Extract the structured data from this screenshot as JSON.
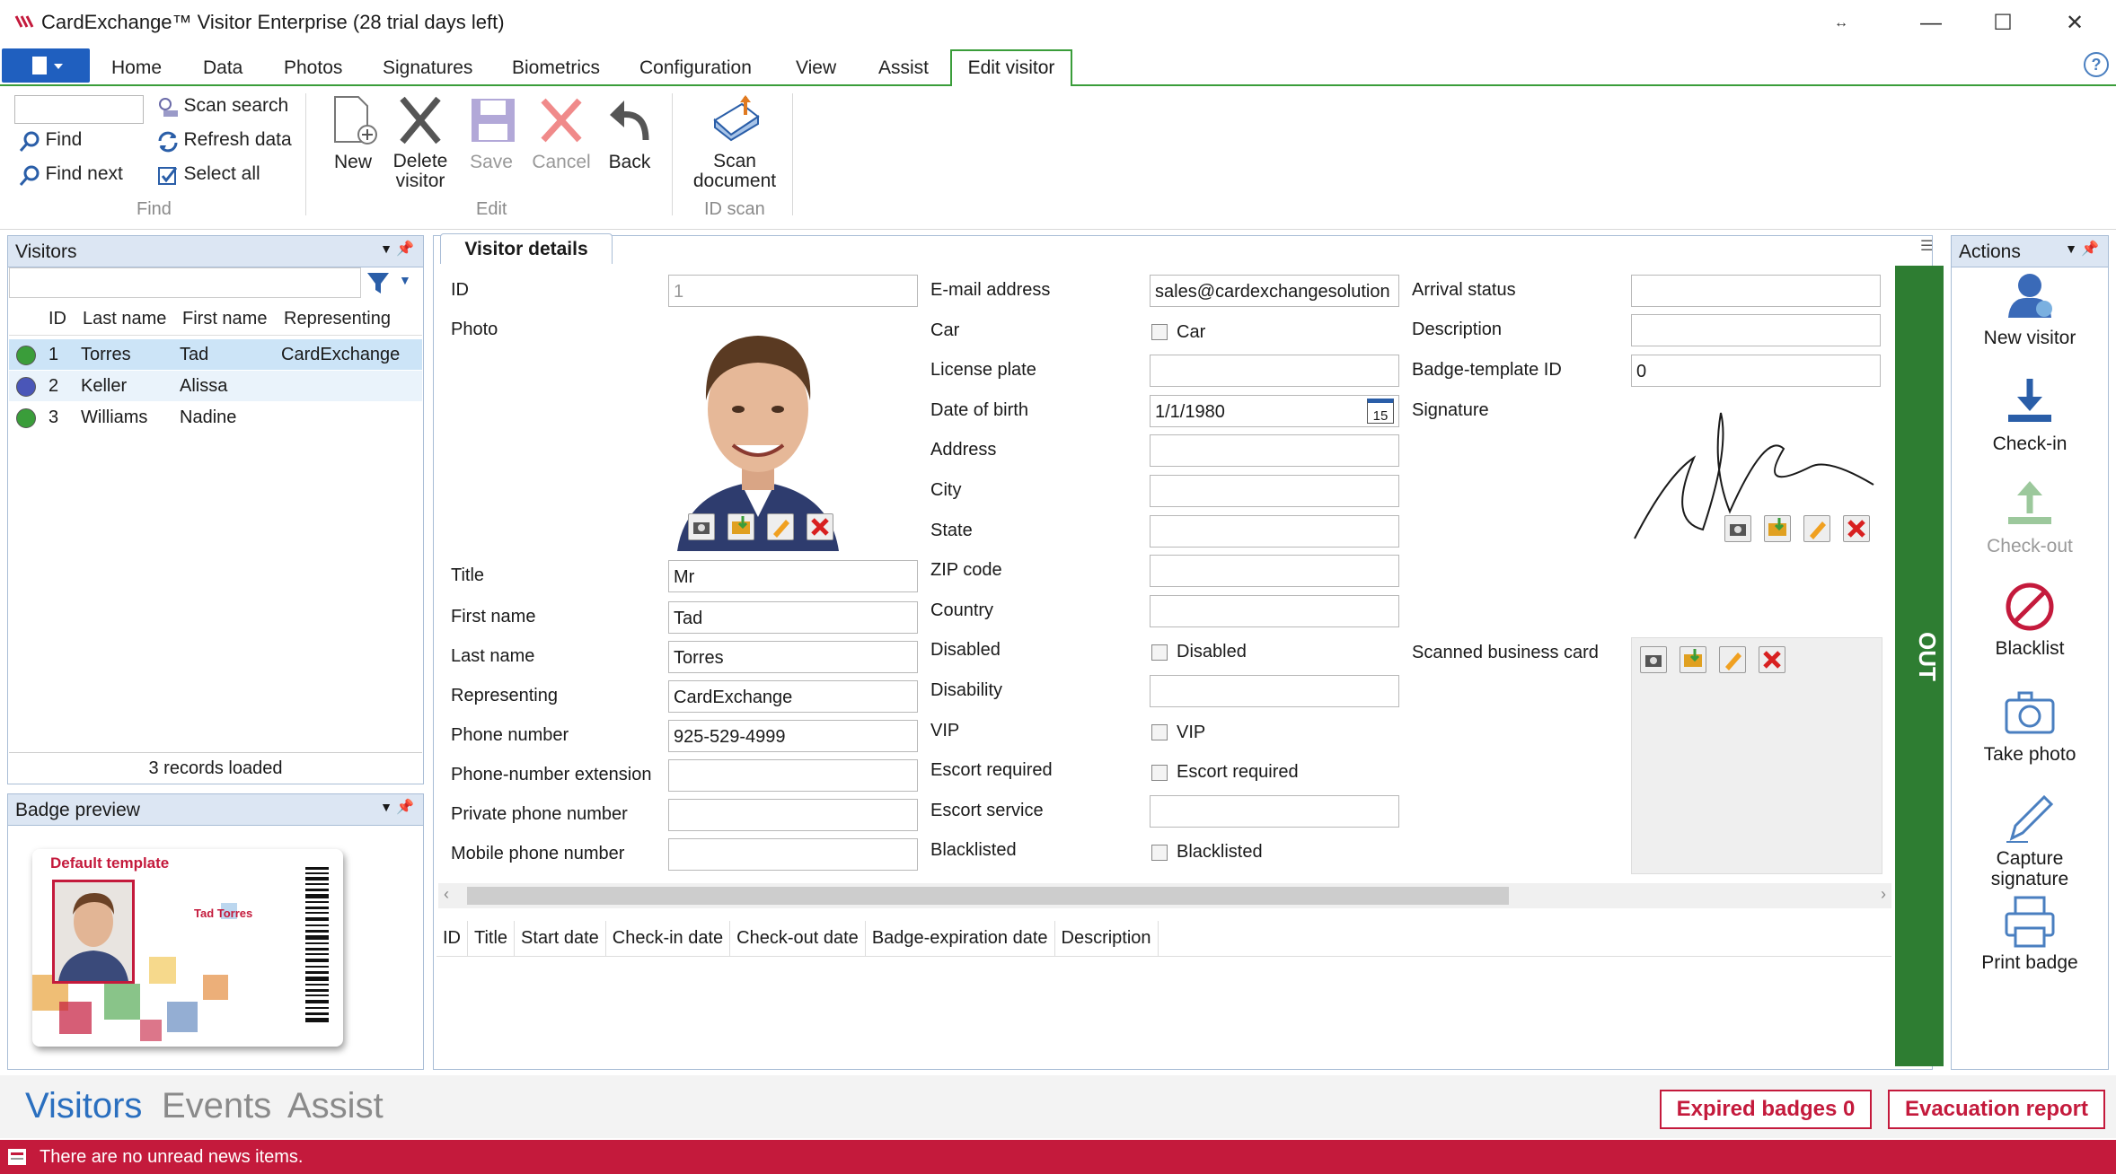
{
  "window": {
    "title": "CardExchange™ Visitor Enterprise (28 trial days left)",
    "help": "?"
  },
  "ribbon_tabs": [
    "Home",
    "Data",
    "Photos",
    "Signatures",
    "Biometrics",
    "Configuration",
    "View",
    "Assist"
  ],
  "active_tab": "Edit visitor",
  "find_group": {
    "label": "Find",
    "search_value": "",
    "find": "Find",
    "find_next": "Find next",
    "scan_search": "Scan search",
    "refresh_data": "Refresh data",
    "select_all": "Select all"
  },
  "edit_group": {
    "label": "Edit",
    "new": "New",
    "delete": "Delete visitor",
    "save": "Save",
    "cancel": "Cancel",
    "back": "Back"
  },
  "idscan_group": {
    "label": "ID scan",
    "scan": "Scan document"
  },
  "visitors_panel": {
    "title": "Visitors",
    "filter_value": "",
    "columns": [
      "ID",
      "Last name",
      "First name",
      "Representing"
    ],
    "rows": [
      {
        "id": "1",
        "last": "Torres",
        "first": "Tad",
        "rep": "CardExchange",
        "status_color": "#3a9d3a"
      },
      {
        "id": "2",
        "last": "Keller",
        "first": "Alissa",
        "rep": "",
        "status_color": "#4a56b8"
      },
      {
        "id": "3",
        "last": "Williams",
        "first": "Nadine",
        "rep": "",
        "status_color": "#3a9d3a"
      }
    ],
    "status": "3 records loaded"
  },
  "badge_panel": {
    "title": "Badge preview",
    "template_name": "Default template",
    "card_name": "Tad Torres"
  },
  "details": {
    "tab": "Visitor details",
    "left": [
      {
        "label": "ID",
        "value": "1"
      },
      {
        "label": "Photo",
        "value": ""
      },
      {
        "label": "Title",
        "value": "Mr"
      },
      {
        "label": "First name",
        "value": "Tad"
      },
      {
        "label": "Last name",
        "value": "Torres"
      },
      {
        "label": "Representing",
        "value": "CardExchange"
      },
      {
        "label": "Phone number",
        "value": "925-529-4999"
      },
      {
        "label": "Phone-number extension",
        "value": ""
      },
      {
        "label": "Private phone number",
        "value": ""
      },
      {
        "label": "Mobile phone number",
        "value": ""
      }
    ],
    "middle": [
      {
        "label": "E-mail address",
        "value": "sales@cardexchangesolution"
      },
      {
        "label": "Car",
        "checkbox": "Car"
      },
      {
        "label": "License plate",
        "value": ""
      },
      {
        "label": "Date of birth",
        "value": "1/1/1980",
        "calendar": "15"
      },
      {
        "label": "Address",
        "value": ""
      },
      {
        "label": "City",
        "value": ""
      },
      {
        "label": "State",
        "value": ""
      },
      {
        "label": "ZIP code",
        "value": ""
      },
      {
        "label": "Country",
        "value": ""
      },
      {
        "label": "Disabled",
        "checkbox": "Disabled"
      },
      {
        "label": "Disability",
        "value": ""
      },
      {
        "label": "VIP",
        "checkbox": "VIP"
      },
      {
        "label": "Escort required",
        "checkbox": "Escort required"
      },
      {
        "label": "Escort service",
        "value": ""
      },
      {
        "label": "Blacklisted",
        "checkbox": "Blacklisted"
      }
    ],
    "right": [
      {
        "label": "Arrival status",
        "value": ""
      },
      {
        "label": "Description",
        "value": ""
      },
      {
        "label": "Badge-template ID",
        "value": "0"
      },
      {
        "label": "Signature",
        "value": ""
      },
      {
        "label": "Scanned business card",
        "value": ""
      }
    ],
    "out_label": "OUT",
    "visits_columns": [
      "ID",
      "Title",
      "Start date",
      "Check-in date",
      "Check-out date",
      "Badge-expiration date",
      "Description"
    ]
  },
  "actions_panel": {
    "title": "Actions",
    "items": [
      {
        "label": "New visitor",
        "icon": "user-icon"
      },
      {
        "label": "Check-in",
        "icon": "download-icon"
      },
      {
        "label": "Check-out",
        "icon": "upload-icon"
      },
      {
        "label": "Blacklist",
        "icon": "ban-icon"
      },
      {
        "label": "Take photo",
        "icon": "camera-icon"
      },
      {
        "label": "Capture signature",
        "icon": "pen-icon"
      },
      {
        "label": "Print badge",
        "icon": "printer-icon"
      }
    ]
  },
  "bottom_nav": {
    "visitors": "Visitors",
    "events": "Events",
    "assist": "Assist",
    "expired": "Expired badges 0",
    "evacuation": "Evacuation report"
  },
  "status_bar": "There are no unread news items.",
  "colors": {
    "accent_green": "#3a9d3a",
    "out_green": "#2e7d32",
    "status_red": "#c41a3c",
    "nav_blue": "#1f5fbf",
    "selected_row": "#cce4f7"
  }
}
